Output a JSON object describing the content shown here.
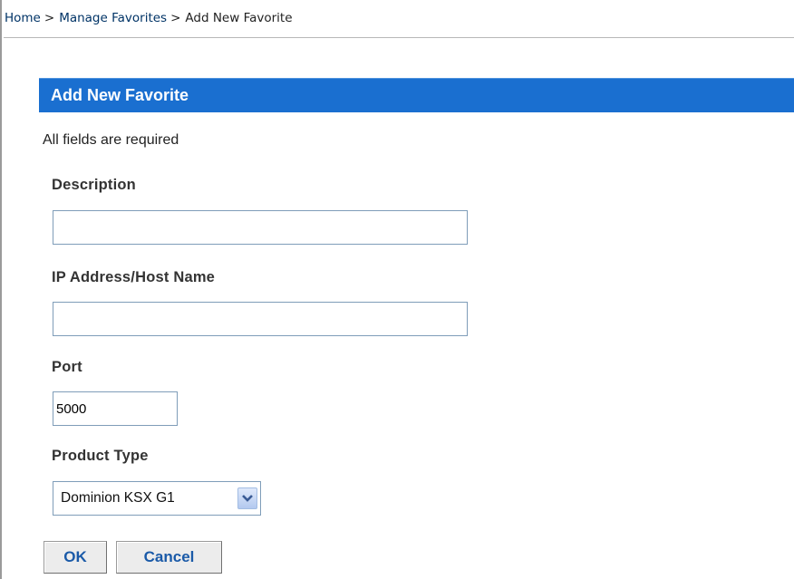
{
  "breadcrumb": {
    "home": "Home",
    "separator": ">",
    "manage_favorites": "Manage Favorites",
    "current": "Add New Favorite"
  },
  "section": {
    "title": "Add New Favorite"
  },
  "form": {
    "required_note": "All fields are required",
    "description": {
      "label": "Description",
      "value": ""
    },
    "ip_address": {
      "label": "IP Address/Host Name",
      "value": ""
    },
    "port": {
      "label": "Port",
      "value": "5000"
    },
    "product_type": {
      "label": "Product Type",
      "selected": "Dominion KSX G1"
    }
  },
  "buttons": {
    "ok": "OK",
    "cancel": "Cancel"
  },
  "colors": {
    "header_bg": "#1a6fd0",
    "button_text": "#1a5aa8",
    "link": "#003366"
  }
}
